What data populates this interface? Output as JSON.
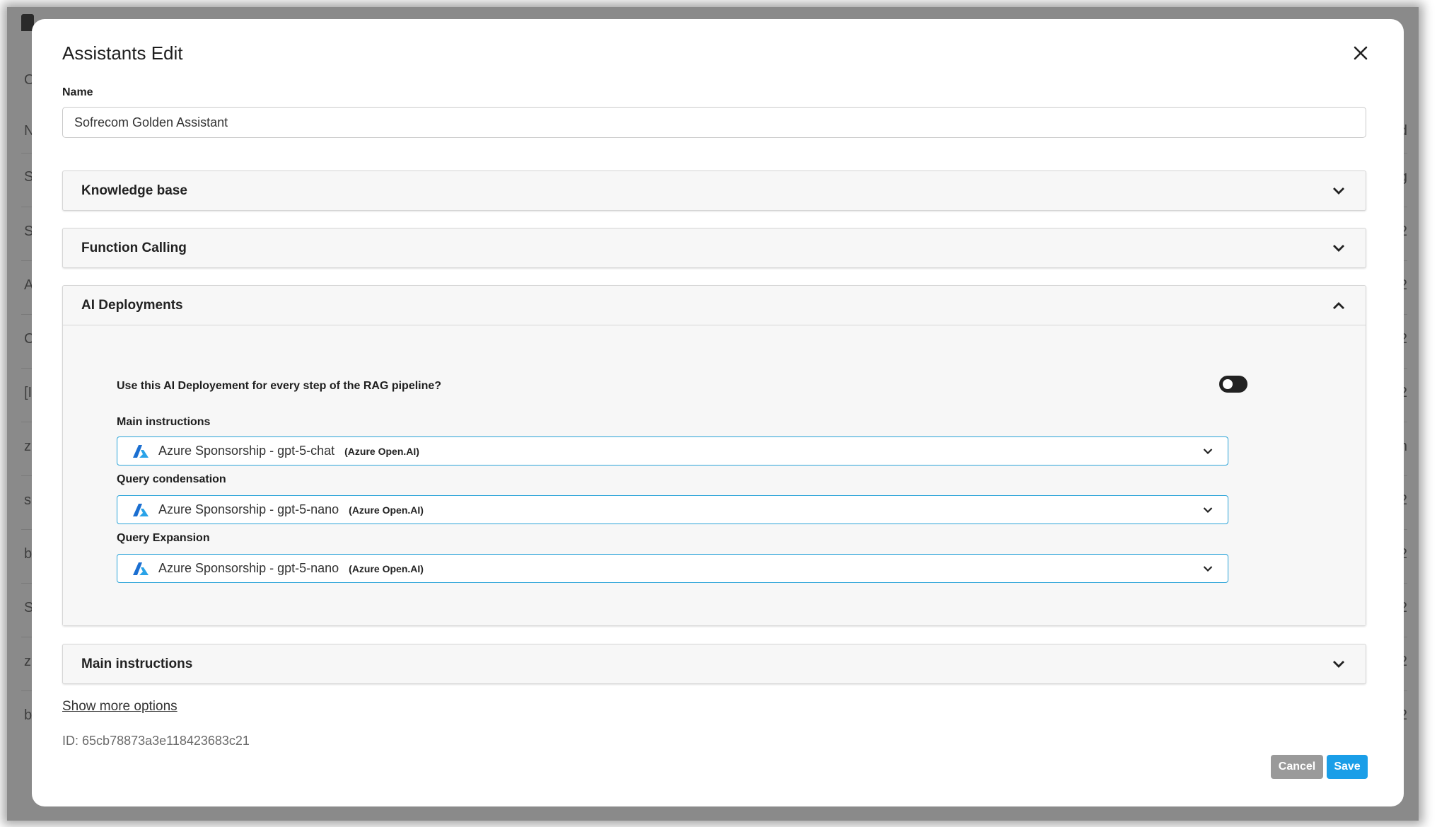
{
  "modal": {
    "title": "Assistants Edit",
    "name_label": "Name",
    "name_value": "Sofrecom Golden Assistant"
  },
  "sections": {
    "knowledge_base": "Knowledge base",
    "function_calling": "Function Calling",
    "ai_deployments": "AI Deployments",
    "main_instructions": "Main instructions"
  },
  "ai_deployments": {
    "question": "Use this AI Deployement for every step of the RAG pipeline?",
    "toggle_on": false,
    "selects": [
      {
        "label": "Main instructions",
        "value": "Azure Sponsorship - gpt-5-chat",
        "provider": "(Azure Open.AI)"
      },
      {
        "label": "Query condensation",
        "value": "Azure Sponsorship - gpt-5-nano",
        "provider": "(Azure Open.AI)"
      },
      {
        "label": "Query Expansion",
        "value": "Azure Sponsorship - gpt-5-nano",
        "provider": "(Azure Open.AI)"
      }
    ]
  },
  "footer": {
    "show_more": "Show more options",
    "id_label": "ID:",
    "id_value": "65cb78873a3e118423683c21",
    "cancel_label": "Cancel",
    "save_label": "Save"
  },
  "background_page": {
    "left_column": [
      "O",
      "N",
      "S",
      "S",
      "A",
      "C",
      "[I",
      "z",
      "s",
      "b",
      "S",
      "z",
      "b"
    ],
    "right_column": [
      "ed",
      "g",
      "l 2",
      "l 2",
      "l 2",
      "l 2",
      "n",
      "y 2",
      "r 2",
      "r 2",
      "r 2",
      "r 2"
    ]
  },
  "colors": {
    "accent": "#1a9ee8",
    "select_border": "#2aa3d8",
    "cancel": "#9a9a9a",
    "overlay": "#8a8a8a"
  },
  "icons": {
    "close": "close-icon",
    "chevron_down": "chevron-down-icon",
    "chevron_up": "chevron-up-icon",
    "azure": "azure-logo-icon"
  }
}
